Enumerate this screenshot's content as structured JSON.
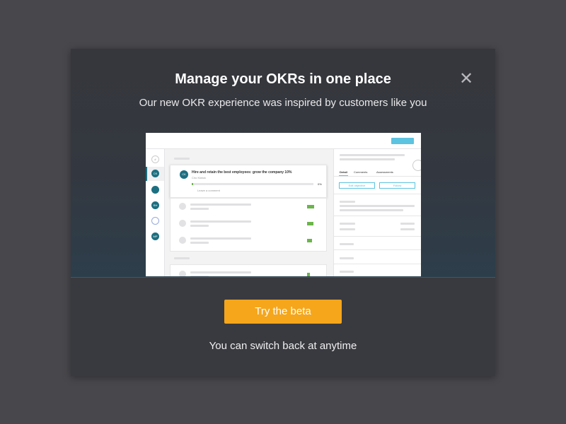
{
  "modal": {
    "title": "Manage your OKRs in one place",
    "subtitle": "Our new OKR experience was inspired by customers like you",
    "close_icon": "close-icon",
    "cta_label": "Try the beta",
    "footnote": "You can switch back at anytime"
  },
  "preview": {
    "sidebar_avatars": [
      "#",
      "CK",
      "",
      "RH",
      "",
      "MP"
    ],
    "objective_initials": "CK",
    "objective_title": "Hire and retain the best employees: grow the company 10%",
    "objective_owner": "Ciro Kiwick",
    "objective_progress": "0%",
    "leave_comment": "Leave a comment",
    "tabs": [
      "Detail",
      "Comments",
      "Assessments"
    ],
    "edit_button": "Edit objective",
    "follow_button": "Follow"
  },
  "colors": {
    "accent": "#f5a61b",
    "teal": "#1c6f80",
    "preview_blue": "#5cc3e0",
    "progress_green": "#6bb54a"
  }
}
